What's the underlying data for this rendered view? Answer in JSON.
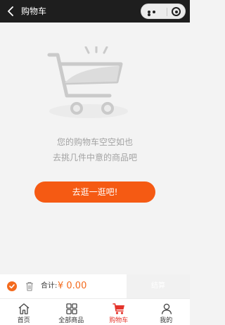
{
  "navbar": {
    "title": "购物车"
  },
  "empty": {
    "line1": "您的购物车空空如也",
    "line2": "去挑几件中意的商品吧"
  },
  "go_button": "去逛一逛吧!",
  "checkout": {
    "total_label": "合计:",
    "total_value": "¥ 0.00",
    "settle_label": "结算"
  },
  "tabbar": {
    "items": [
      {
        "label": "首页",
        "icon": "home-icon"
      },
      {
        "label": "全部商品",
        "icon": "grid-icon"
      },
      {
        "label": "购物车",
        "icon": "cart-icon",
        "active": true
      },
      {
        "label": "我的",
        "icon": "user-icon"
      }
    ]
  },
  "colors": {
    "accent": "#f55a13",
    "tab_active": "#e4342b",
    "navbar": "#1e1e1e"
  }
}
